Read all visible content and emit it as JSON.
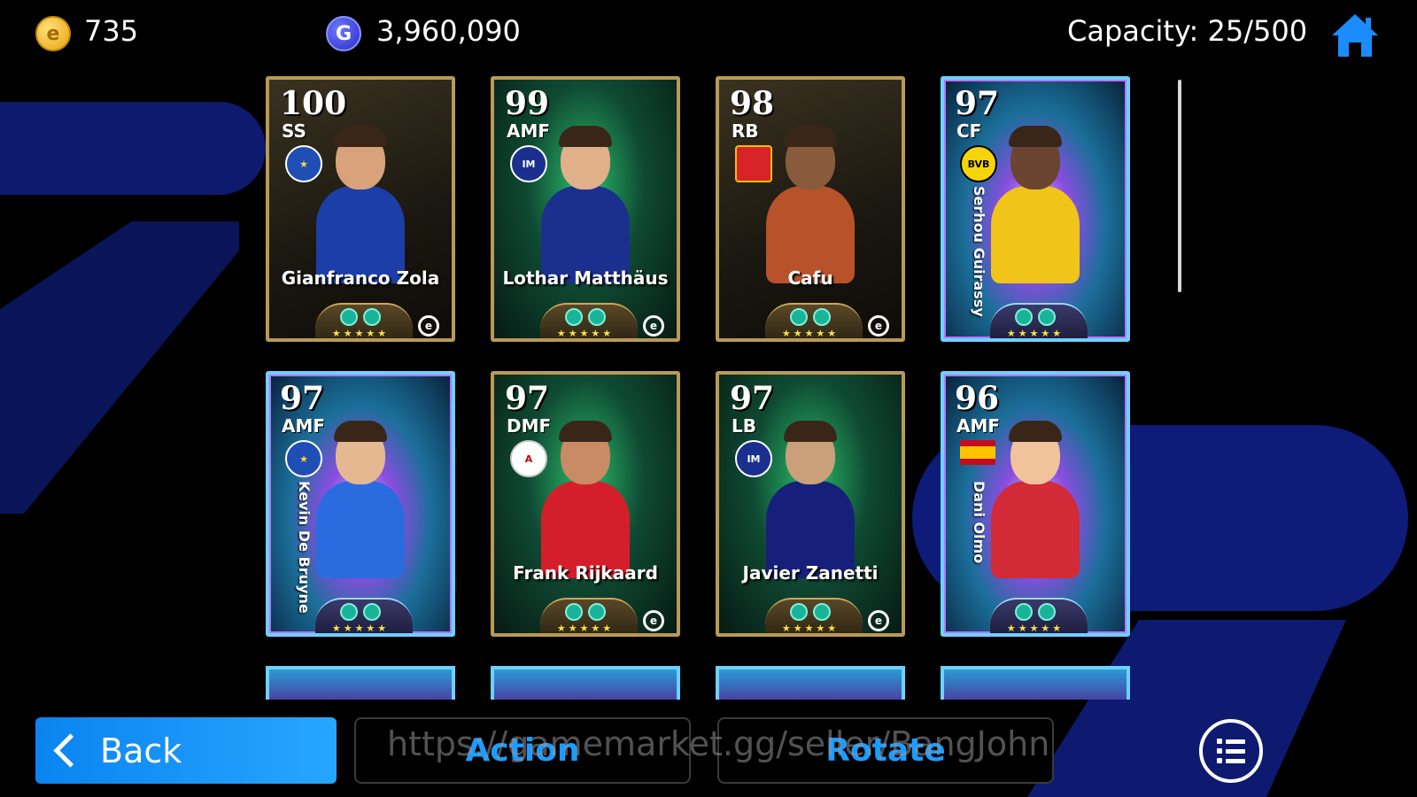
{
  "topbar": {
    "coins": "735",
    "gp": "3,960,090",
    "capacity": "Capacity: 25/500",
    "coin_icon": "efootball-coin-icon",
    "gp_icon": "gp-icon",
    "home_icon": "home-icon"
  },
  "cards": [
    {
      "rating": "100",
      "position": "SS",
      "name": "Gianfranco Zola",
      "style": "legend",
      "badge": "blue",
      "stars": "★★★★★"
    },
    {
      "rating": "99",
      "position": "AMF",
      "name": "Lothar Matthäus",
      "style": "green",
      "badge": "inter",
      "stars": "★★★★★"
    },
    {
      "rating": "98",
      "position": "RB",
      "name": "Cafu",
      "style": "legend",
      "badge": "red",
      "stars": "★★★★★"
    },
    {
      "rating": "97",
      "position": "CF",
      "name": "Serhou Guirassy",
      "style": "holo",
      "badge": "bvb",
      "stars": "★★★★★"
    },
    {
      "rating": "97",
      "position": "AMF",
      "name": "Kevin De Bruyne",
      "style": "holo",
      "badge": "blue",
      "stars": "★★★★★"
    },
    {
      "rating": "97",
      "position": "DMF",
      "name": "Frank Rijkaard",
      "style": "green",
      "badge": "ajax",
      "stars": "★★★★★"
    },
    {
      "rating": "97",
      "position": "LB",
      "name": "Javier Zanetti",
      "style": "green",
      "badge": "inter",
      "stars": "★★★★★"
    },
    {
      "rating": "96",
      "position": "AMF",
      "name": "Dani Olmo",
      "style": "holo",
      "badge": "flag",
      "stars": "★★★★★"
    }
  ],
  "badge_text": {
    "bvb": "BVB",
    "inter": "IM",
    "blue": "★",
    "red": "",
    "ajax": "A"
  },
  "bottom": {
    "back_label": "Back",
    "action_label": "Action",
    "rotate_label": "Rotate",
    "menu_icon": "list-menu-icon",
    "watermark": "https://gamemarket.gg/seller/BangJohn"
  },
  "colors": {
    "accent_blue": "#1b9dff",
    "back_button": "#0a84f0",
    "legend_frame": "#b99a55",
    "holo_frame": "#6fd0ff"
  }
}
